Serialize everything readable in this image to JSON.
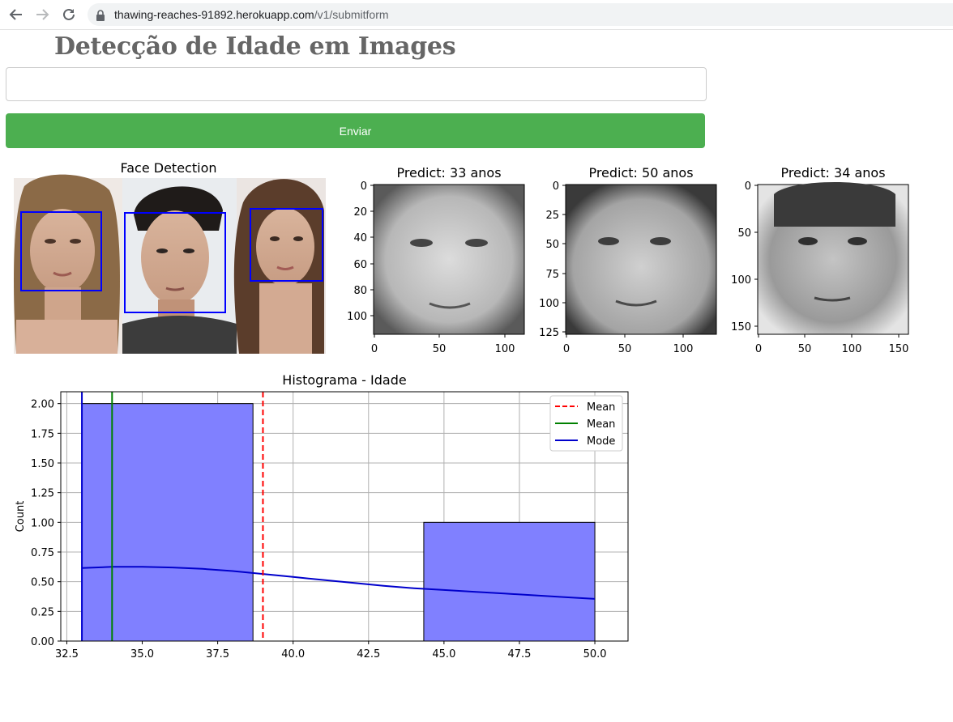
{
  "browser": {
    "url_host": "thawing-reaches-91892.herokuapp.com",
    "url_path": "/v1/submitform"
  },
  "page": {
    "title": "Detecção de Idade em Images",
    "input_value": "",
    "submit_label": "Enviar"
  },
  "face_detection": {
    "title": "Face Detection"
  },
  "predictions": [
    {
      "title": "Predict: 33 anos",
      "y_ticks": [
        "0",
        "20",
        "40",
        "60",
        "80",
        "100"
      ],
      "x_ticks": [
        "0",
        "50",
        "100"
      ]
    },
    {
      "title": "Predict: 50 anos",
      "y_ticks": [
        "0",
        "25",
        "50",
        "75",
        "100",
        "125"
      ],
      "x_ticks": [
        "0",
        "50",
        "100"
      ]
    },
    {
      "title": "Predict: 34 anos",
      "y_ticks": [
        "0",
        "50",
        "100",
        "150"
      ],
      "x_ticks": [
        "0",
        "50",
        "100",
        "150"
      ]
    }
  ],
  "chart_data": {
    "type": "bar",
    "title": "Histograma - Idade",
    "xlabel": "",
    "ylabel": "Count",
    "xlim": [
      32.3,
      51.1
    ],
    "ylim": [
      0,
      2.1
    ],
    "x_ticks": [
      "32.5",
      "35.0",
      "37.5",
      "40.0",
      "42.5",
      "45.0",
      "47.5",
      "50.0"
    ],
    "y_ticks": [
      "0.00",
      "0.25",
      "0.50",
      "0.75",
      "1.00",
      "1.25",
      "1.50",
      "1.75",
      "2.00"
    ],
    "grid": true,
    "bins": [
      {
        "x0": 33.0,
        "x1": 38.67,
        "count": 2
      },
      {
        "x0": 38.67,
        "x1": 44.33,
        "count": 0
      },
      {
        "x0": 44.33,
        "x1": 50.0,
        "count": 1
      }
    ],
    "bar_color": "#8080ff",
    "kde": {
      "x": [
        33,
        34,
        35,
        36,
        37,
        38,
        39,
        40,
        41,
        42,
        43,
        44,
        45,
        46,
        47,
        48,
        49,
        50
      ],
      "y": [
        0.615,
        0.625,
        0.625,
        0.62,
        0.608,
        0.59,
        0.565,
        0.54,
        0.515,
        0.49,
        0.465,
        0.445,
        0.43,
        0.415,
        0.4,
        0.385,
        0.37,
        0.355
      ],
      "color": "#0000cc"
    },
    "lines": [
      {
        "name": "Mean",
        "x": 39.0,
        "style": "dashed",
        "color": "#ff0000"
      },
      {
        "name": "Mean",
        "x": 34.0,
        "style": "solid",
        "color": "#008000"
      },
      {
        "name": "Mode",
        "x": 33.0,
        "style": "solid",
        "color": "#0000cc"
      }
    ],
    "legend": "top-right"
  }
}
